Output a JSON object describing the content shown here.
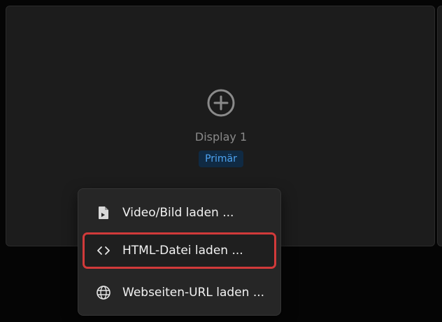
{
  "display": {
    "name": "Display 1",
    "badge": "Primär",
    "add_icon": "plus-circle-icon"
  },
  "menu": {
    "items": [
      {
        "label": "Video/Bild laden ...",
        "icon": "file-video-icon",
        "highlighted": false
      },
      {
        "label": "HTML-Datei laden ...",
        "icon": "code-icon",
        "highlighted": true
      },
      {
        "label": "Webseiten-URL laden ...",
        "icon": "globe-icon",
        "highlighted": false
      }
    ]
  },
  "colors": {
    "background": "#050505",
    "card": "#1c1c1c",
    "menu": "#262626",
    "accent_blue": "#4ea3f0",
    "badge_bg": "#102a43",
    "highlight_border": "#d13a3a"
  }
}
